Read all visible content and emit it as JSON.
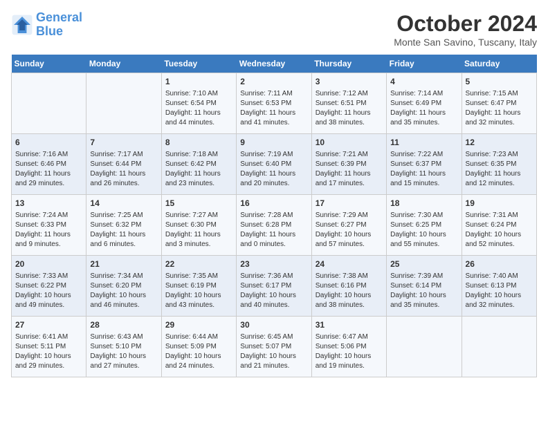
{
  "logo": {
    "line1": "General",
    "line2": "Blue"
  },
  "title": "October 2024",
  "location": "Monte San Savino, Tuscany, Italy",
  "days_header": [
    "Sunday",
    "Monday",
    "Tuesday",
    "Wednesday",
    "Thursday",
    "Friday",
    "Saturday"
  ],
  "weeks": [
    [
      {
        "day": "",
        "info": ""
      },
      {
        "day": "",
        "info": ""
      },
      {
        "day": "1",
        "info": "Sunrise: 7:10 AM\nSunset: 6:54 PM\nDaylight: 11 hours and 44 minutes."
      },
      {
        "day": "2",
        "info": "Sunrise: 7:11 AM\nSunset: 6:53 PM\nDaylight: 11 hours and 41 minutes."
      },
      {
        "day": "3",
        "info": "Sunrise: 7:12 AM\nSunset: 6:51 PM\nDaylight: 11 hours and 38 minutes."
      },
      {
        "day": "4",
        "info": "Sunrise: 7:14 AM\nSunset: 6:49 PM\nDaylight: 11 hours and 35 minutes."
      },
      {
        "day": "5",
        "info": "Sunrise: 7:15 AM\nSunset: 6:47 PM\nDaylight: 11 hours and 32 minutes."
      }
    ],
    [
      {
        "day": "6",
        "info": "Sunrise: 7:16 AM\nSunset: 6:46 PM\nDaylight: 11 hours and 29 minutes."
      },
      {
        "day": "7",
        "info": "Sunrise: 7:17 AM\nSunset: 6:44 PM\nDaylight: 11 hours and 26 minutes."
      },
      {
        "day": "8",
        "info": "Sunrise: 7:18 AM\nSunset: 6:42 PM\nDaylight: 11 hours and 23 minutes."
      },
      {
        "day": "9",
        "info": "Sunrise: 7:19 AM\nSunset: 6:40 PM\nDaylight: 11 hours and 20 minutes."
      },
      {
        "day": "10",
        "info": "Sunrise: 7:21 AM\nSunset: 6:39 PM\nDaylight: 11 hours and 17 minutes."
      },
      {
        "day": "11",
        "info": "Sunrise: 7:22 AM\nSunset: 6:37 PM\nDaylight: 11 hours and 15 minutes."
      },
      {
        "day": "12",
        "info": "Sunrise: 7:23 AM\nSunset: 6:35 PM\nDaylight: 11 hours and 12 minutes."
      }
    ],
    [
      {
        "day": "13",
        "info": "Sunrise: 7:24 AM\nSunset: 6:33 PM\nDaylight: 11 hours and 9 minutes."
      },
      {
        "day": "14",
        "info": "Sunrise: 7:25 AM\nSunset: 6:32 PM\nDaylight: 11 hours and 6 minutes."
      },
      {
        "day": "15",
        "info": "Sunrise: 7:27 AM\nSunset: 6:30 PM\nDaylight: 11 hours and 3 minutes."
      },
      {
        "day": "16",
        "info": "Sunrise: 7:28 AM\nSunset: 6:28 PM\nDaylight: 11 hours and 0 minutes."
      },
      {
        "day": "17",
        "info": "Sunrise: 7:29 AM\nSunset: 6:27 PM\nDaylight: 10 hours and 57 minutes."
      },
      {
        "day": "18",
        "info": "Sunrise: 7:30 AM\nSunset: 6:25 PM\nDaylight: 10 hours and 55 minutes."
      },
      {
        "day": "19",
        "info": "Sunrise: 7:31 AM\nSunset: 6:24 PM\nDaylight: 10 hours and 52 minutes."
      }
    ],
    [
      {
        "day": "20",
        "info": "Sunrise: 7:33 AM\nSunset: 6:22 PM\nDaylight: 10 hours and 49 minutes."
      },
      {
        "day": "21",
        "info": "Sunrise: 7:34 AM\nSunset: 6:20 PM\nDaylight: 10 hours and 46 minutes."
      },
      {
        "day": "22",
        "info": "Sunrise: 7:35 AM\nSunset: 6:19 PM\nDaylight: 10 hours and 43 minutes."
      },
      {
        "day": "23",
        "info": "Sunrise: 7:36 AM\nSunset: 6:17 PM\nDaylight: 10 hours and 40 minutes."
      },
      {
        "day": "24",
        "info": "Sunrise: 7:38 AM\nSunset: 6:16 PM\nDaylight: 10 hours and 38 minutes."
      },
      {
        "day": "25",
        "info": "Sunrise: 7:39 AM\nSunset: 6:14 PM\nDaylight: 10 hours and 35 minutes."
      },
      {
        "day": "26",
        "info": "Sunrise: 7:40 AM\nSunset: 6:13 PM\nDaylight: 10 hours and 32 minutes."
      }
    ],
    [
      {
        "day": "27",
        "info": "Sunrise: 6:41 AM\nSunset: 5:11 PM\nDaylight: 10 hours and 29 minutes."
      },
      {
        "day": "28",
        "info": "Sunrise: 6:43 AM\nSunset: 5:10 PM\nDaylight: 10 hours and 27 minutes."
      },
      {
        "day": "29",
        "info": "Sunrise: 6:44 AM\nSunset: 5:09 PM\nDaylight: 10 hours and 24 minutes."
      },
      {
        "day": "30",
        "info": "Sunrise: 6:45 AM\nSunset: 5:07 PM\nDaylight: 10 hours and 21 minutes."
      },
      {
        "day": "31",
        "info": "Sunrise: 6:47 AM\nSunset: 5:06 PM\nDaylight: 10 hours and 19 minutes."
      },
      {
        "day": "",
        "info": ""
      },
      {
        "day": "",
        "info": ""
      }
    ]
  ]
}
